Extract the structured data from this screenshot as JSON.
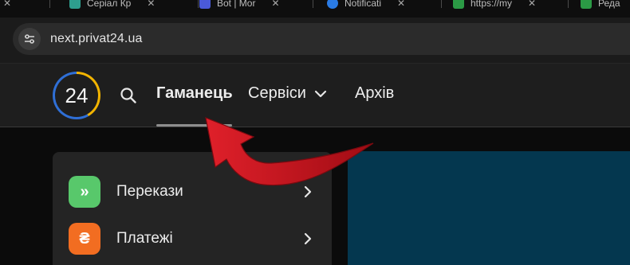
{
  "browser": {
    "tabs": [
      {
        "label": "",
        "favicon_color": "#1a1a1a"
      },
      {
        "label": "Серіал  Кр",
        "favicon_color": "#2e9e8e"
      },
      {
        "label": "Bot | Mor",
        "favicon_color": "#4a5ad8"
      },
      {
        "label": "Notificati",
        "favicon_color": "#2a7be4"
      },
      {
        "label": "https://my",
        "favicon_color": "#2b9a45"
      },
      {
        "label": "Реда",
        "favicon_color": "#2b9a45"
      }
    ],
    "url": "next.privat24.ua"
  },
  "header": {
    "logo_text": "24",
    "nav": {
      "wallet": "Гаманець",
      "services": "Сервіси",
      "archive": "Архів"
    }
  },
  "menu": {
    "items": [
      {
        "label": "Перекази",
        "icon_glyph": "»",
        "icon": "double-chevron-icon",
        "color": "#58c86b"
      },
      {
        "label": "Платежі",
        "icon_glyph": "₴",
        "icon": "hryvnia-icon",
        "color": "#f26d21"
      }
    ]
  },
  "colors": {
    "logo_yellow": "#f2b400",
    "logo_blue": "#2f6fd6",
    "banner": "#04374f",
    "arrow_red": "#c4111a"
  }
}
